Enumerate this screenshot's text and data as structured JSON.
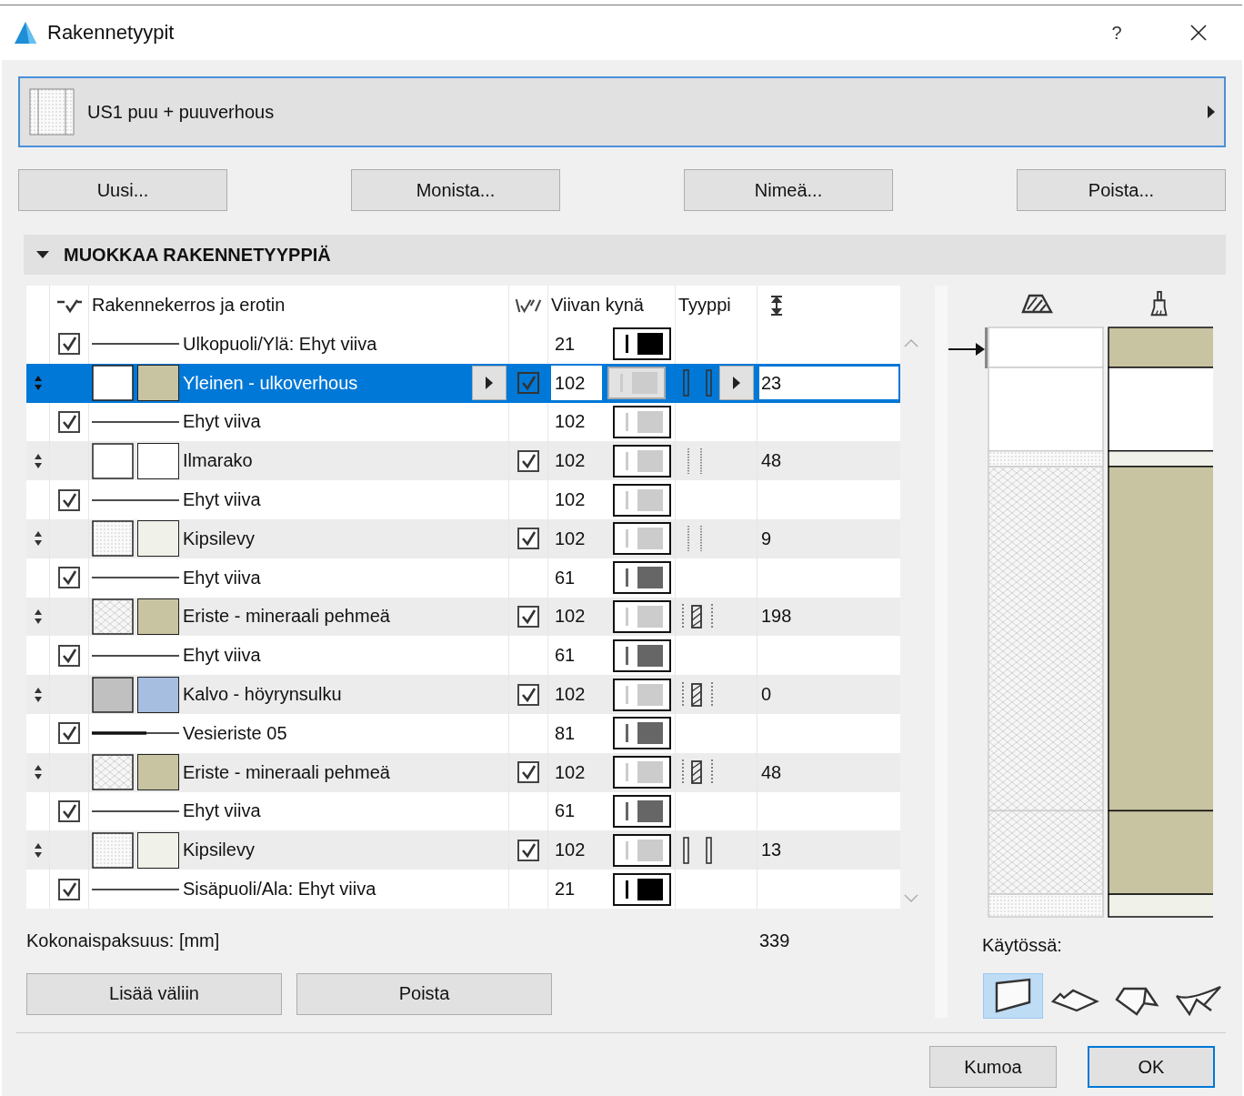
{
  "window": {
    "title": "Rakennetyypit",
    "help": "?"
  },
  "structure": {
    "name": "US1 puu + puuverhous"
  },
  "buttons": [
    "Uusi...",
    "Monista...",
    "Nimeä...",
    "Poista..."
  ],
  "section": {
    "title": "MUOKKAA RAKENNETYYPPIÄ",
    "expanded": true
  },
  "columns": {
    "name": "Rakennekerros ja erotin",
    "pen": "Viivan kynä",
    "type": "Tyyppi"
  },
  "rows": [
    {
      "kind": "line",
      "selected": false,
      "checked": true,
      "line_style": {
        "kind": "thin"
      },
      "name": "Ulkopuoli/Ylä: Ehyt viiva",
      "pen": {
        "number": "21",
        "color": "#000000"
      }
    },
    {
      "kind": "layer",
      "selected": true,
      "fill": {
        "kind": "empty"
      },
      "color": "#c8c4a2",
      "name": "Yleinen - ulkoverhous",
      "checked": true,
      "pen": {
        "number": "102",
        "color": "#cccccc"
      },
      "layer_type": {
        "kind": "finish"
      },
      "thickness": "23"
    },
    {
      "kind": "line",
      "selected": false,
      "checked": true,
      "line_style": {
        "kind": "thin"
      },
      "name": "Ehyt viiva",
      "pen": {
        "number": "102",
        "color": "#cccccc"
      }
    },
    {
      "kind": "layer",
      "selected": false,
      "fill": {
        "kind": "empty"
      },
      "color": "#ffffff",
      "name": "Ilmarako",
      "checked": true,
      "pen": {
        "number": "102",
        "color": "#cccccc"
      },
      "layer_type": {
        "kind": "other"
      },
      "thickness": "48"
    },
    {
      "kind": "line",
      "selected": false,
      "checked": true,
      "line_style": {
        "kind": "thin"
      },
      "name": "Ehyt viiva",
      "pen": {
        "number": "102",
        "color": "#cccccc"
      }
    },
    {
      "kind": "layer",
      "selected": false,
      "fill": {
        "kind": "dots"
      },
      "color": "#f0f2ea",
      "name": "Kipsilevy",
      "checked": true,
      "pen": {
        "number": "102",
        "color": "#cccccc"
      },
      "layer_type": {
        "kind": "other"
      },
      "thickness": "9"
    },
    {
      "kind": "line",
      "selected": false,
      "checked": true,
      "line_style": {
        "kind": "thin"
      },
      "name": "Ehyt viiva",
      "pen": {
        "number": "61",
        "color": "#666666"
      }
    },
    {
      "kind": "layer",
      "selected": false,
      "fill": {
        "kind": "crosshatch"
      },
      "color": "#c8c4a2",
      "name": "Eriste - mineraali pehmeä",
      "checked": true,
      "pen": {
        "number": "102",
        "color": "#cccccc"
      },
      "layer_type": {
        "kind": "core"
      },
      "thickness": "198"
    },
    {
      "kind": "line",
      "selected": false,
      "checked": true,
      "line_style": {
        "kind": "thin"
      },
      "name": "Ehyt viiva",
      "pen": {
        "number": "61",
        "color": "#666666"
      }
    },
    {
      "kind": "layer",
      "selected": false,
      "fill": {
        "kind": "grey"
      },
      "color": "#a6bedf",
      "name": "Kalvo - höyrynsulku",
      "checked": true,
      "pen": {
        "number": "102",
        "color": "#cccccc"
      },
      "layer_type": {
        "kind": "core"
      },
      "thickness": "0"
    },
    {
      "kind": "line",
      "selected": false,
      "checked": true,
      "line_style": {
        "kind": "thick"
      },
      "name": "Vesieriste 05",
      "pen": {
        "number": "81",
        "color": "#666666"
      }
    },
    {
      "kind": "layer",
      "selected": false,
      "fill": {
        "kind": "crosshatch"
      },
      "color": "#c8c4a2",
      "name": "Eriste - mineraali pehmeä",
      "checked": true,
      "pen": {
        "number": "102",
        "color": "#cccccc"
      },
      "layer_type": {
        "kind": "core"
      },
      "thickness": "48"
    },
    {
      "kind": "line",
      "selected": false,
      "checked": true,
      "line_style": {
        "kind": "thin"
      },
      "name": "Ehyt viiva",
      "pen": {
        "number": "61",
        "color": "#666666"
      }
    },
    {
      "kind": "layer",
      "selected": false,
      "fill": {
        "kind": "dots"
      },
      "color": "#f0f2ea",
      "name": "Kipsilevy",
      "checked": true,
      "pen": {
        "number": "102",
        "color": "#cccccc"
      },
      "layer_type": {
        "kind": "finish"
      },
      "thickness": "13"
    },
    {
      "kind": "line",
      "selected": false,
      "checked": true,
      "line_style": {
        "kind": "thin"
      },
      "name": "Sisäpuoli/Ala: Ehyt viiva",
      "pen": {
        "number": "21",
        "color": "#000000"
      }
    }
  ],
  "total": {
    "label": "Kokonaispaksuus: [mm]",
    "value": "339"
  },
  "row_buttons": [
    "Lisää väliin",
    "Poista"
  ],
  "usage": {
    "label": "Käytössä:",
    "shapes": [
      {
        "kind": "wall",
        "selected": true
      },
      {
        "kind": "slab",
        "selected": false
      },
      {
        "kind": "roof",
        "selected": false
      },
      {
        "kind": "shell",
        "selected": false
      }
    ]
  },
  "dialog_buttons": [
    {
      "label": "Kumoa",
      "default": false
    },
    {
      "label": "OK",
      "default": true
    }
  ]
}
